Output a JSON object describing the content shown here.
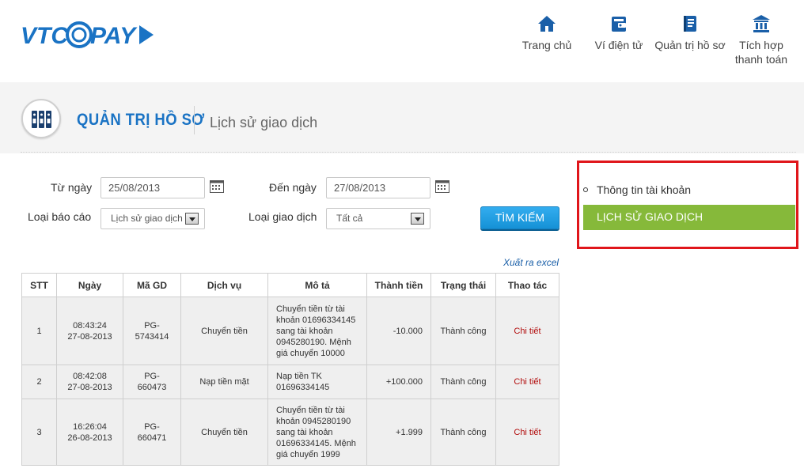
{
  "header": {
    "logo_text": "VTC PAY",
    "nav": [
      {
        "label": "Trang chủ",
        "icon": "home-icon"
      },
      {
        "label": "Ví điện tử",
        "icon": "wallet-icon"
      },
      {
        "label": "Quản trị hồ sơ",
        "icon": "profile-book-icon"
      },
      {
        "label_line1": "Tích hợp",
        "label_line2": "thanh toán",
        "icon": "bank-icon"
      }
    ]
  },
  "titlebar": {
    "main": "QUẢN TRỊ HỒ SƠ",
    "sub": "Lịch sử giao dịch",
    "icon": "binders-icon"
  },
  "form": {
    "from_label": "Từ ngày",
    "from_value": "25/08/2013",
    "to_label": "Đến ngày",
    "to_value": "27/08/2013",
    "report_type_label": "Loại báo cáo",
    "report_type_value": "Lịch sử giao dịch",
    "tx_type_label": "Loại giao dịch",
    "tx_type_value": "Tất cả",
    "search_button": "TÌM KIẾM",
    "export_link": "Xuất ra excel"
  },
  "table": {
    "columns": [
      "STT",
      "Ngày",
      "Mã GD",
      "Dịch vụ",
      "Mô tả",
      "Thành tiền",
      "Trạng thái",
      "Thao tác"
    ],
    "rows": [
      {
        "stt": "1",
        "time": "08:43:24",
        "date": "27-08-2013",
        "code_line1": "PG-",
        "code_line2": "5743414",
        "service": "Chuyển tiền",
        "desc": [
          "Chuyển tiền từ tài",
          "khoản 01696334145",
          "sang tài khoản",
          "0945280190. Mệnh",
          "giá chuyển 10000"
        ],
        "amount": "-10.000",
        "status": "Thành công",
        "action": "Chi tiết"
      },
      {
        "stt": "2",
        "time": "08:42:08",
        "date": "27-08-2013",
        "code_line1": "PG-",
        "code_line2": "660473",
        "service": "Nạp tiền mặt",
        "desc": [
          "Nạp tiền TK",
          "01696334145"
        ],
        "amount": "+100.000",
        "status": "Thành công",
        "action": "Chi tiết"
      },
      {
        "stt": "3",
        "time": "16:26:04",
        "date": "26-08-2013",
        "code_line1": "PG-",
        "code_line2": "660471",
        "service": "Chuyển tiền",
        "desc": [
          "Chuyển tiền từ tài",
          "khoản 0945280190",
          "sang tài khoản",
          "01696334145. Mệnh",
          "giá chuyển 1999"
        ],
        "amount": "+1.999",
        "status": "Thành công",
        "action": "Chi tiết"
      }
    ]
  },
  "side": {
    "item1": "Thông tin tài khoản",
    "item2": "LỊCH SỬ GIAO DỊCH"
  },
  "colors": {
    "brand_blue": "#1a73c4",
    "button_blue": "#1e9fe3",
    "active_green": "#86b93a",
    "highlight_red": "#e0161b",
    "action_red": "#b20c0c"
  }
}
